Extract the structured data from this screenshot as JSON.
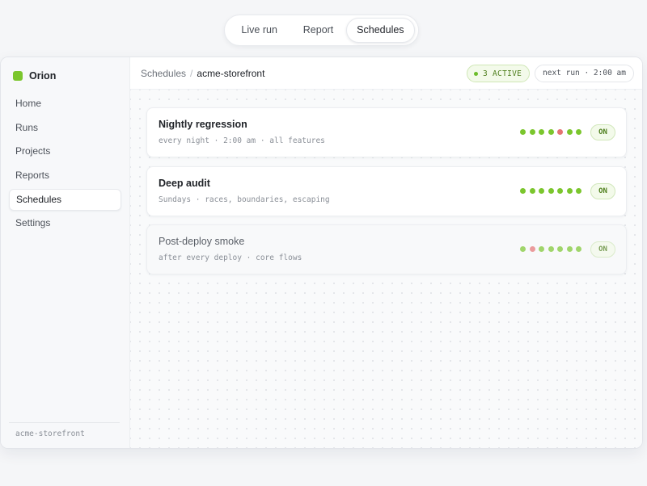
{
  "tabs": [
    {
      "label": "Live run",
      "active": false
    },
    {
      "label": "Report",
      "active": false
    },
    {
      "label": "Schedules",
      "active": true
    }
  ],
  "brand": {
    "name": "Orion",
    "color": "#7bc62d"
  },
  "sidebar": {
    "items": [
      {
        "label": "Home",
        "active": false
      },
      {
        "label": "Runs",
        "active": false
      },
      {
        "label": "Projects",
        "active": false
      },
      {
        "label": "Reports",
        "active": false
      },
      {
        "label": "Schedules",
        "active": true
      },
      {
        "label": "Settings",
        "active": false
      }
    ],
    "footer": "acme-storefront"
  },
  "header": {
    "breadcrumb": [
      "Schedules",
      "acme-storefront"
    ],
    "separator": "/",
    "active_badge": "3 ACTIVE",
    "next_run": "next run · 2:00 am"
  },
  "colors": {
    "pass": "#7bc62d",
    "fail": "#e57373",
    "accent": "#7bc62d"
  },
  "schedules": [
    {
      "title": "Nightly regression",
      "subtitle": "every night · 2:00 am · all features",
      "history": [
        "pass",
        "pass",
        "pass",
        "pass",
        "fail",
        "pass",
        "pass"
      ],
      "toggle": "ON",
      "muted": false
    },
    {
      "title": "Deep audit",
      "subtitle": "Sundays · races, boundaries, escaping",
      "history": [
        "pass",
        "pass",
        "pass",
        "pass",
        "pass",
        "pass",
        "pass"
      ],
      "toggle": "ON",
      "muted": false
    },
    {
      "title": "Post-deploy smoke",
      "subtitle": "after every deploy · core flows",
      "history": [
        "pass",
        "fail",
        "pass",
        "pass",
        "pass",
        "pass",
        "pass"
      ],
      "toggle": "ON",
      "muted": true
    }
  ]
}
